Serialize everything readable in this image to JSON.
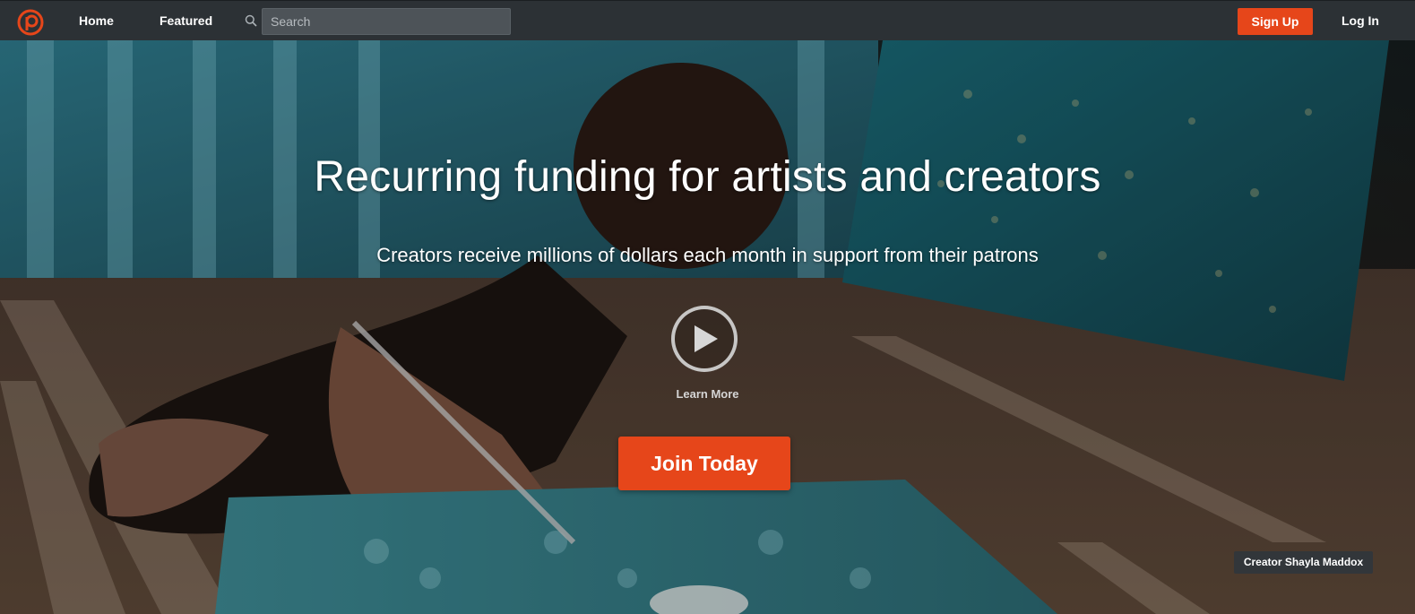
{
  "nav": {
    "home_label": "Home",
    "featured_label": "Featured",
    "search_placeholder": "Search",
    "signup_label": "Sign Up",
    "login_label": "Log In"
  },
  "hero": {
    "title": "Recurring funding for artists and creators",
    "subtitle": "Creators receive millions of dollars each month in support from their patrons",
    "learn_more_label": "Learn More",
    "cta_label": "Join Today",
    "photo_credit": "Creator Shayla Maddox"
  },
  "colors": {
    "brand_orange": "#e6461a",
    "nav_bg": "#2c3135",
    "search_bg": "#4d5358",
    "credit_bg": "#30363c"
  },
  "icons": [
    "patreon-logo-icon",
    "search-icon",
    "play-icon"
  ]
}
